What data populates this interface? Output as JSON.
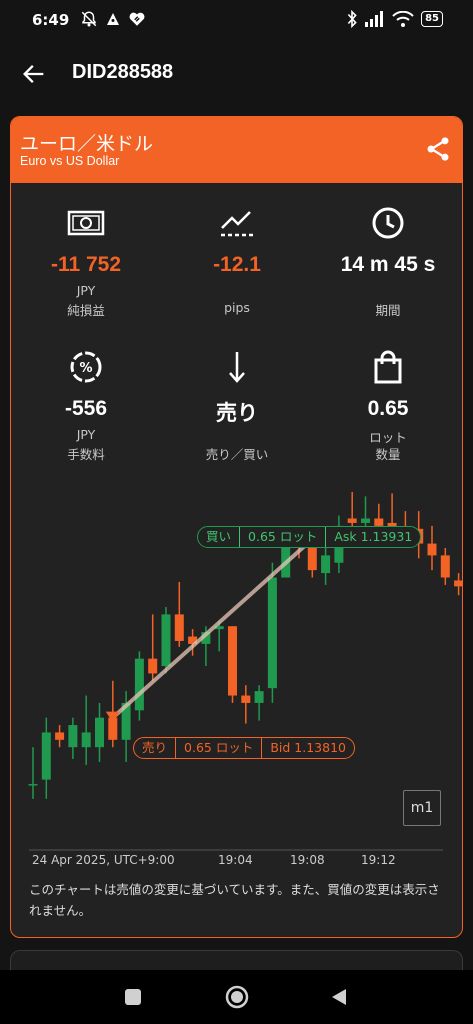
{
  "status_bar": {
    "time": "6:49",
    "left_icons": [
      "notifications-off-icon",
      "app-notification-icon",
      "heart-link-icon"
    ],
    "right_icons": [
      "bluetooth-icon",
      "signal-icon",
      "wifi-icon"
    ],
    "battery": "85"
  },
  "app_bar": {
    "title": "DID288588"
  },
  "pair": {
    "title": "ユーロ／米ドル",
    "subtitle": "Euro vs US Dollar"
  },
  "stats": {
    "net_pl": {
      "value": "-11 752",
      "unit": "JPY",
      "label": "純損益",
      "icon": "banknote-icon"
    },
    "pips": {
      "value": "-12.1",
      "unit": "",
      "label": "pips",
      "icon": "trend-chart-icon"
    },
    "duration": {
      "value": "14 m 45 s",
      "unit": "",
      "label": "期間",
      "icon": "clock-icon"
    },
    "commission": {
      "value": "-556",
      "unit": "JPY",
      "label": "手数料",
      "icon": "percent-icon"
    },
    "direction": {
      "value": "売り",
      "unit": "",
      "label": "売り／買い",
      "icon": "arrow-down-icon"
    },
    "lot": {
      "value": "0.65",
      "unit": "ロット",
      "label": "数量",
      "icon": "bag-icon"
    }
  },
  "colors": {
    "accent": "#f26325",
    "up": "#1f9a4e",
    "down": "#f26325",
    "background": "#141414",
    "card": "#222222"
  },
  "chart_data": {
    "type": "candlestick",
    "timeframe": "m1",
    "x_labels": [
      "24 Apr 2025, UTC+9:00",
      "19:04",
      "19:08",
      "19:12"
    ],
    "candles": [
      {
        "o": 1.13765,
        "h": 1.1379,
        "l": 1.13755,
        "c": 1.13765
      },
      {
        "o": 1.13768,
        "h": 1.1381,
        "l": 1.13755,
        "c": 1.138
      },
      {
        "o": 1.138,
        "h": 1.13805,
        "l": 1.1379,
        "c": 1.13795
      },
      {
        "o": 1.1379,
        "h": 1.1381,
        "l": 1.13782,
        "c": 1.13805
      },
      {
        "o": 1.1379,
        "h": 1.13825,
        "l": 1.13778,
        "c": 1.138
      },
      {
        "o": 1.1379,
        "h": 1.1382,
        "l": 1.1378,
        "c": 1.1381
      },
      {
        "o": 1.1381,
        "h": 1.13835,
        "l": 1.1379,
        "c": 1.13795
      },
      {
        "o": 1.13795,
        "h": 1.13828,
        "l": 1.1378,
        "c": 1.1382
      },
      {
        "o": 1.13815,
        "h": 1.13855,
        "l": 1.13808,
        "c": 1.1385
      },
      {
        "o": 1.1385,
        "h": 1.1388,
        "l": 1.13835,
        "c": 1.1384
      },
      {
        "o": 1.13845,
        "h": 1.13885,
        "l": 1.1384,
        "c": 1.1388
      },
      {
        "o": 1.1388,
        "h": 1.13902,
        "l": 1.13858,
        "c": 1.13862
      },
      {
        "o": 1.13865,
        "h": 1.1387,
        "l": 1.13852,
        "c": 1.1386
      },
      {
        "o": 1.1386,
        "h": 1.13872,
        "l": 1.13845,
        "c": 1.13868
      },
      {
        "o": 1.1387,
        "h": 1.13876,
        "l": 1.13855,
        "c": 1.13872
      },
      {
        "o": 1.13872,
        "h": 1.13872,
        "l": 1.1382,
        "c": 1.13825
      },
      {
        "o": 1.13825,
        "h": 1.13832,
        "l": 1.13806,
        "c": 1.1382
      },
      {
        "o": 1.1382,
        "h": 1.13832,
        "l": 1.13808,
        "c": 1.13828
      },
      {
        "o": 1.1383,
        "h": 1.13915,
        "l": 1.1382,
        "c": 1.13905
      },
      {
        "o": 1.13905,
        "h": 1.13932,
        "l": 1.13905,
        "c": 1.13928
      },
      {
        "o": 1.13928,
        "h": 1.13933,
        "l": 1.13918,
        "c": 1.13925
      },
      {
        "o": 1.13928,
        "h": 1.13938,
        "l": 1.13905,
        "c": 1.1391
      },
      {
        "o": 1.13908,
        "h": 1.13935,
        "l": 1.139,
        "c": 1.1392
      },
      {
        "o": 1.13915,
        "h": 1.13947,
        "l": 1.13908,
        "c": 1.1394
      },
      {
        "o": 1.13945,
        "h": 1.13963,
        "l": 1.13938,
        "c": 1.13942
      },
      {
        "o": 1.13942,
        "h": 1.1396,
        "l": 1.13935,
        "c": 1.13945
      },
      {
        "o": 1.13945,
        "h": 1.13955,
        "l": 1.13935,
        "c": 1.1394
      },
      {
        "o": 1.13942,
        "h": 1.13962,
        "l": 1.13925,
        "c": 1.13936
      },
      {
        "o": 1.13936,
        "h": 1.1395,
        "l": 1.1393,
        "c": 1.13932
      },
      {
        "o": 1.13938,
        "h": 1.1395,
        "l": 1.13918,
        "c": 1.13928
      },
      {
        "o": 1.13928,
        "h": 1.1394,
        "l": 1.1391,
        "c": 1.1392
      },
      {
        "o": 1.1392,
        "h": 1.13925,
        "l": 1.139,
        "c": 1.13905
      },
      {
        "o": 1.13903,
        "h": 1.13908,
        "l": 1.13893,
        "c": 1.13899
      }
    ],
    "trade": {
      "entry": {
        "side": "売り",
        "lots": "0.65 ロット",
        "price_label": "Bid 1.13810",
        "price": 1.1381,
        "candle_index": 6
      },
      "exit": {
        "side": "買い",
        "lots": "0.65 ロット",
        "price_label": "Ask 1.13931",
        "price": 1.13931,
        "candle_index": 21
      }
    },
    "grid": false
  },
  "chart_note": "このチャートは売値の変更に基づいています。また、買値の変更は表示されません。",
  "nav": {
    "buttons": [
      "recents-button",
      "home-button",
      "back-button"
    ]
  }
}
